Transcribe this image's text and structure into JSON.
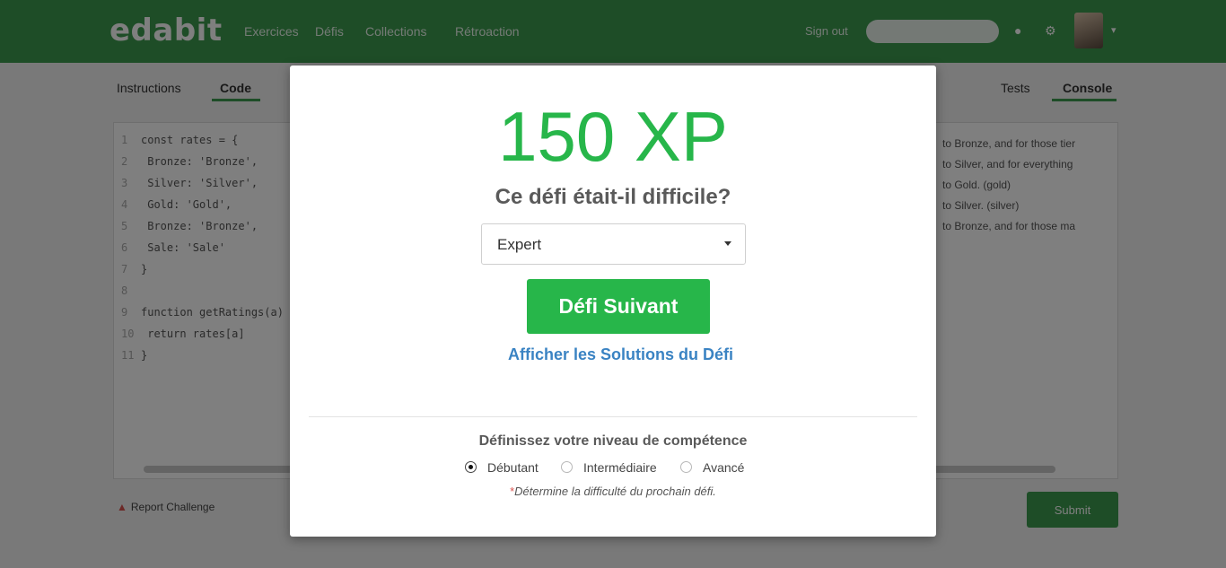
{
  "background": {
    "brand": "edabit",
    "nav_links": [
      "Exercices",
      "Défis",
      "Collections",
      "Rétroaction"
    ],
    "signin": "Sign out",
    "tabs": [
      "Instructions",
      "Code",
      "Tests",
      "Console"
    ],
    "report_label": "Report Challenge",
    "submit_label": "Submit",
    "code_lines": [
      {
        "num": "1",
        "text": "const rates = {"
      },
      {
        "num": "2",
        "text": "  Bronze: 'Bronze',"
      },
      {
        "num": "3",
        "text": "  Silver: 'Silver',"
      },
      {
        "num": "4",
        "text": "  Gold: 'Gold',"
      },
      {
        "num": "5",
        "text": "  Bronze: 'Bronze',"
      },
      {
        "num": "6",
        "text": "  Sale: 'Sale'"
      },
      {
        "num": "7",
        "text": "}"
      },
      {
        "num": "8",
        "text": ""
      },
      {
        "num": "9",
        "text": "function getRatings(a) {"
      },
      {
        "num": "10",
        "text": "    return rates[a]"
      },
      {
        "num": "11",
        "text": "}"
      }
    ],
    "instruction_lines": [
      "to Bronze, and for those tier",
      "to Silver, and for everything",
      "to Gold. (gold)",
      "to Silver. (silver)",
      "to Bronze, and for those ma"
    ]
  },
  "modal": {
    "xp": "150 XP",
    "question": "Ce défi était-il difficile?",
    "difficulty_selected": "Expert",
    "next_button": "Défi Suivant",
    "solutions_link": "Afficher les Solutions du Défi",
    "skill_title": "Définissez votre niveau de compétence",
    "skill_options": [
      {
        "label": "Débutant",
        "checked": true
      },
      {
        "label": "Intermédiaire",
        "checked": false
      },
      {
        "label": "Avancé",
        "checked": false
      }
    ],
    "note_asterisk": "*",
    "note": "Détermine la difficulté du prochain défi."
  },
  "colors": {
    "accent_green": "#27b64a",
    "link_blue": "#3a83c3",
    "navbar_green": "#3c9a4f"
  }
}
